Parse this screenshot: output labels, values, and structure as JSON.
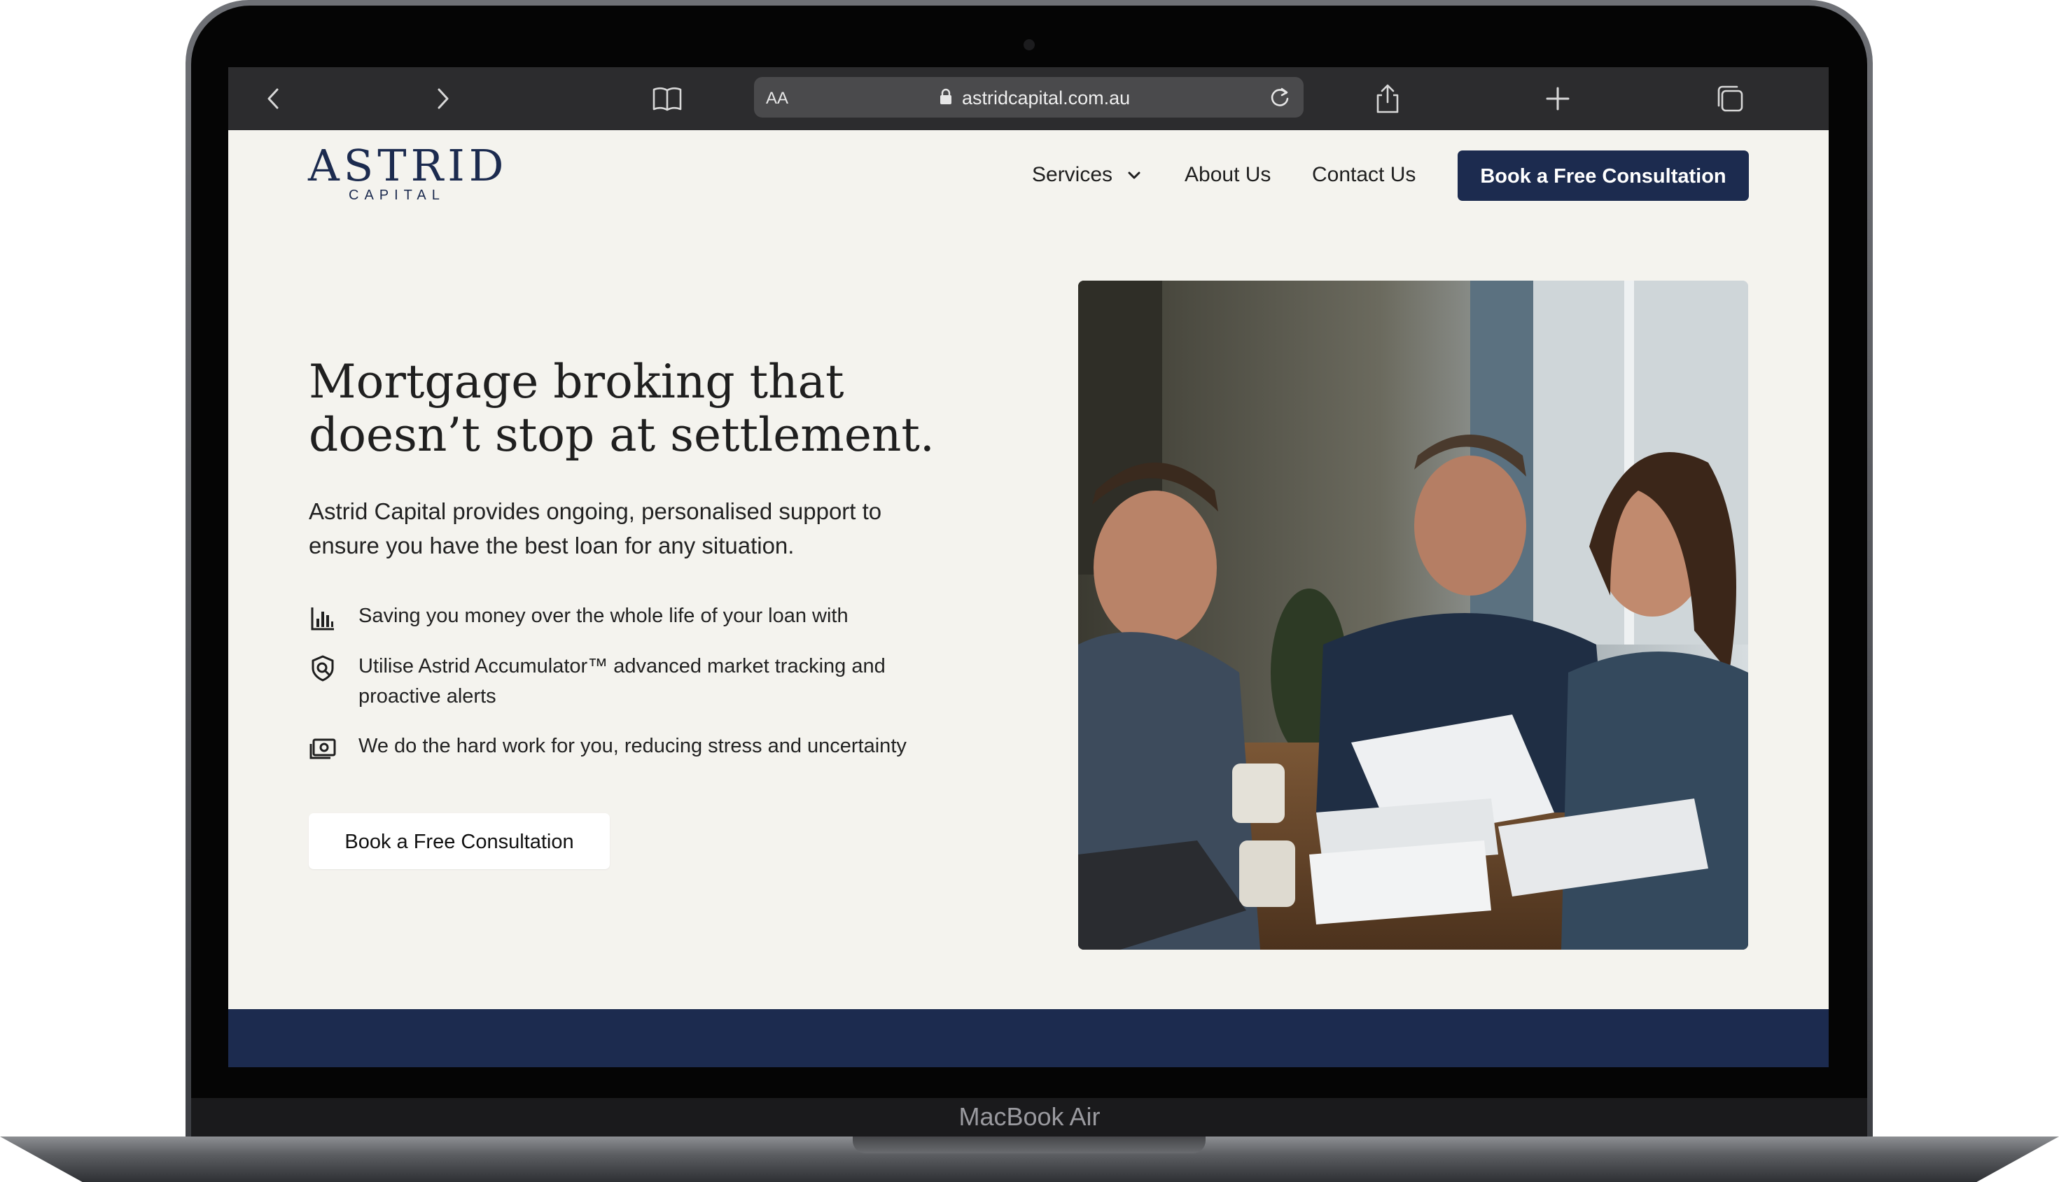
{
  "device": {
    "label": "MacBook Air"
  },
  "browser": {
    "text_size_label": "AA",
    "url": "astridcapital.com.au",
    "icons": [
      "back-icon",
      "forward-icon",
      "bookmarks-icon",
      "lock-icon",
      "reload-icon",
      "share-icon",
      "new-tab-icon",
      "tabs-icon"
    ]
  },
  "site": {
    "logo": {
      "name": "ASTRID",
      "tagline": "CAPITAL"
    },
    "nav": {
      "services": "Services",
      "about": "About Us",
      "contact": "Contact Us",
      "cta": "Book a Free Consultation"
    },
    "hero": {
      "title_line1": "Mortgage broking that",
      "title_line2": "doesn’t stop at settlement.",
      "subtitle": "Astrid Capital provides ongoing, personalised support to ensure you have the best loan for any situation.",
      "features": [
        {
          "icon": "bar-chart-icon",
          "text": "Saving you money over the whole life of your loan with"
        },
        {
          "icon": "shield-search-icon",
          "text": "Utilise Astrid Accumulator™ advanced market tracking and proactive alerts"
        },
        {
          "icon": "cash-icon",
          "text": "We do the hard work for you, reducing stress and uncertainty"
        }
      ],
      "cta": "Book a Free Consultation",
      "photo": "three-people-reviewing-documents-photo"
    },
    "colors": {
      "brand_navy": "#1c2b4f",
      "page_bg": "#f4f3ee",
      "toolbar": "#2c2c2e"
    }
  }
}
